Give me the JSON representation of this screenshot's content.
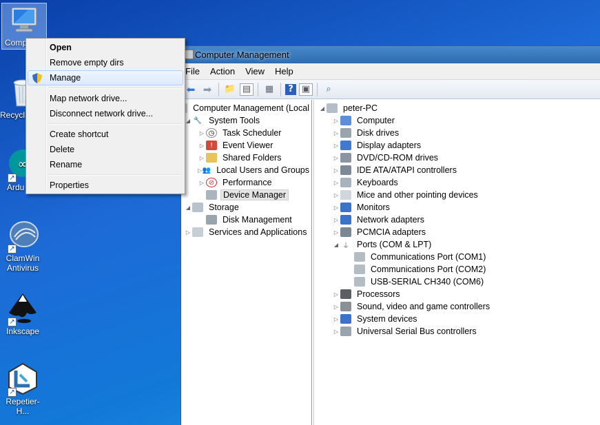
{
  "desktop": {
    "icons": [
      {
        "label": "Comp",
        "selected": true
      },
      {
        "label": "Recycl"
      },
      {
        "label": "Ardu"
      },
      {
        "label": "ClamWin Antivirus"
      },
      {
        "label": "Inkscape"
      },
      {
        "label": "Repetier-H..."
      }
    ]
  },
  "context_menu": {
    "items": [
      {
        "label": "Open",
        "bold": true
      },
      {
        "label": "Remove empty dirs"
      },
      {
        "label": "Manage",
        "hover": true,
        "icon": "uac-shield-icon"
      },
      {
        "separator": true
      },
      {
        "label": "Map network drive..."
      },
      {
        "label": "Disconnect network drive..."
      },
      {
        "separator": true
      },
      {
        "label": "Create shortcut"
      },
      {
        "label": "Delete"
      },
      {
        "label": "Rename"
      },
      {
        "separator": true
      },
      {
        "label": "Properties"
      }
    ]
  },
  "window": {
    "title": "Computer Management",
    "menu": [
      "File",
      "Action",
      "View",
      "Help"
    ],
    "left_tree": {
      "root": "Computer Management (Local",
      "system_tools": "System Tools",
      "system_tools_children": [
        "Task Scheduler",
        "Event Viewer",
        "Shared Folders",
        "Local Users and Groups",
        "Performance",
        "Device Manager"
      ],
      "storage": "Storage",
      "storage_children": [
        "Disk Management"
      ],
      "services": "Services and Applications"
    },
    "device_tree": {
      "root": "peter-PC",
      "categories": [
        "Computer",
        "Disk drives",
        "Display adapters",
        "DVD/CD-ROM drives",
        "IDE ATA/ATAPI controllers",
        "Keyboards",
        "Mice and other pointing devices",
        "Monitors",
        "Network adapters",
        "PCMCIA adapters"
      ],
      "ports": "Ports (COM & LPT)",
      "ports_children": [
        "Communications Port (COM1)",
        "Communications Port (COM2)",
        "USB-SERIAL CH340 (COM6)"
      ],
      "categories_after": [
        "Processors",
        "Sound, video and game controllers",
        "System devices",
        "Universal Serial Bus controllers"
      ]
    }
  },
  "colors": {
    "desktop_top": "#0a3fa8",
    "desktop_bottom": "#2aa0ea",
    "menu_hover_border": "#aecff7"
  }
}
